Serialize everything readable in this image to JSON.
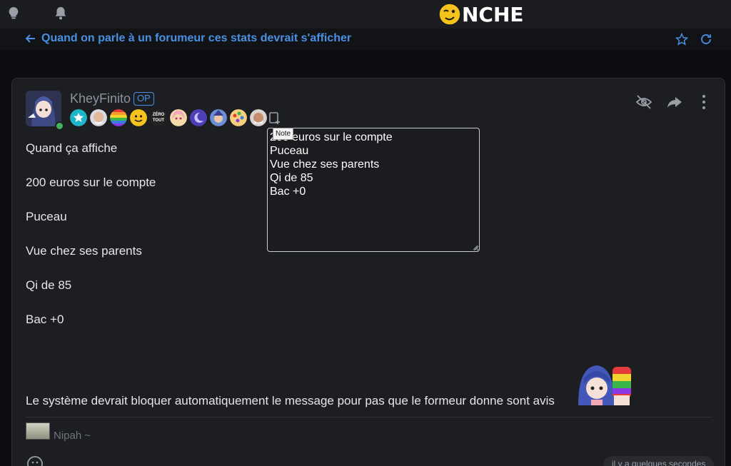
{
  "header": {
    "brand": "NCHE",
    "icons": [
      "lightbulb-icon",
      "bell-icon"
    ]
  },
  "subheader": {
    "back_icon": "arrow-left-icon",
    "topic_title": "Quand on parle à un forumeur ces stats devrait s'afficher",
    "icons": [
      "star-icon",
      "refresh-icon"
    ]
  },
  "post": {
    "author": "KheyFinito",
    "op_label": "OP",
    "online": true,
    "badge_count": 10,
    "badges": [
      {
        "name": "star-badge-icon",
        "color": "#1fb5c8"
      },
      {
        "name": "old-man-badge-icon",
        "color": "#b8a08a"
      },
      {
        "name": "rainbow-badge-icon",
        "color": "#e9a52a"
      },
      {
        "name": "smiley-badge-icon",
        "color": "#f2c744"
      },
      {
        "name": "zero-tout-badge-icon",
        "label": "ZÉRO TOUT",
        "color": "#222222"
      },
      {
        "name": "anime-girl-badge-icon",
        "color": "#f4a7b9"
      },
      {
        "name": "moon-badge-icon",
        "color": "#5b4cc4"
      },
      {
        "name": "wizard-badge-icon",
        "color": "#6b8fd6"
      },
      {
        "name": "palette-badge-icon",
        "color": "#f08a2b"
      },
      {
        "name": "grandpa-badge-icon",
        "color": "#c7a58f"
      }
    ],
    "note_tooltip": "Note",
    "note_text": "200 euros sur le compte\nPuceau\nVue chez ses parents\nQi de 85\nBac +0",
    "actions": [
      "eye-slash-icon",
      "share-icon",
      "more-vertical-icon"
    ],
    "lines": [
      "Quand ça affiche",
      "200 euros sur le compte",
      "Puceau",
      "Vue chez ses parents",
      "Qi de 85",
      "Bac +0",
      "Le système devrait bloquer automatiquement le message pour pas que le formeur donne sont avis"
    ],
    "signature": "Nipah ~",
    "timestamp": "il y a quelques secondes"
  },
  "colors": {
    "accent": "#4a90e2",
    "online": "#43b25a",
    "background": "#0c0d10",
    "card": "#1d1e22"
  }
}
